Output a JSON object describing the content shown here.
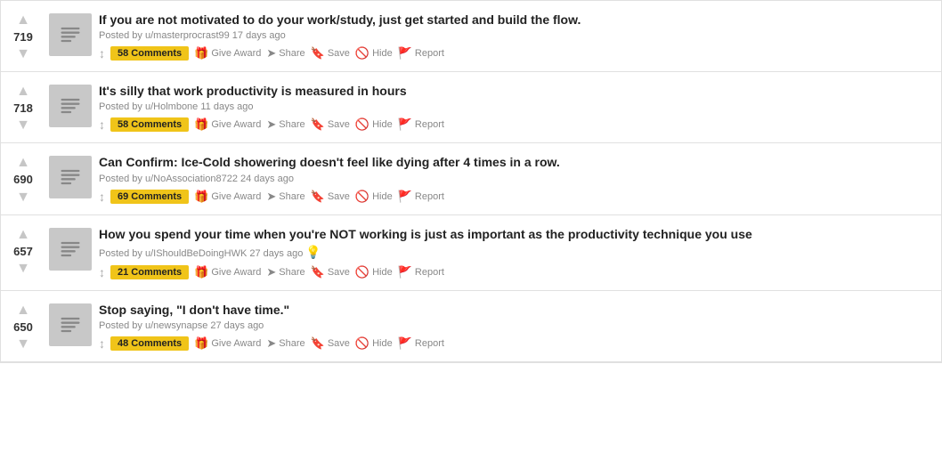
{
  "posts": [
    {
      "id": "post-1",
      "vote_count": "719",
      "title": "If you are not motivated to do your work/study, just get started and build the flow.",
      "author": "u/masterprocrast99",
      "time": "17 days ago",
      "comments_count": "58 Comments",
      "has_emoji": false,
      "emoji": ""
    },
    {
      "id": "post-2",
      "vote_count": "718",
      "title": "It's silly that work productivity is measured in hours",
      "author": "u/Holmbone",
      "time": "11 days ago",
      "comments_count": "58 Comments",
      "has_emoji": false,
      "emoji": ""
    },
    {
      "id": "post-3",
      "vote_count": "690",
      "title": "Can Confirm: Ice-Cold showering doesn't feel like dying after 4 times in a row.",
      "author": "u/NoAssociation8722",
      "time": "24 days ago",
      "comments_count": "69 Comments",
      "has_emoji": false,
      "emoji": ""
    },
    {
      "id": "post-4",
      "vote_count": "657",
      "title": "How you spend your time when you're NOT working is just as important as the productivity technique you use",
      "author": "u/IShouldBeDoingHWK",
      "time": "27 days ago",
      "comments_count": "21 Comments",
      "has_emoji": true,
      "emoji": "💡"
    },
    {
      "id": "post-5",
      "vote_count": "650",
      "title": "Stop saying, \"I don't have time.\"",
      "author": "u/newsynapse",
      "time": "27 days ago",
      "comments_count": "48 Comments",
      "has_emoji": false,
      "emoji": ""
    }
  ],
  "actions": {
    "give_award": "Give Award",
    "share": "Share",
    "save": "Save",
    "hide": "Hide",
    "report": "Report"
  }
}
